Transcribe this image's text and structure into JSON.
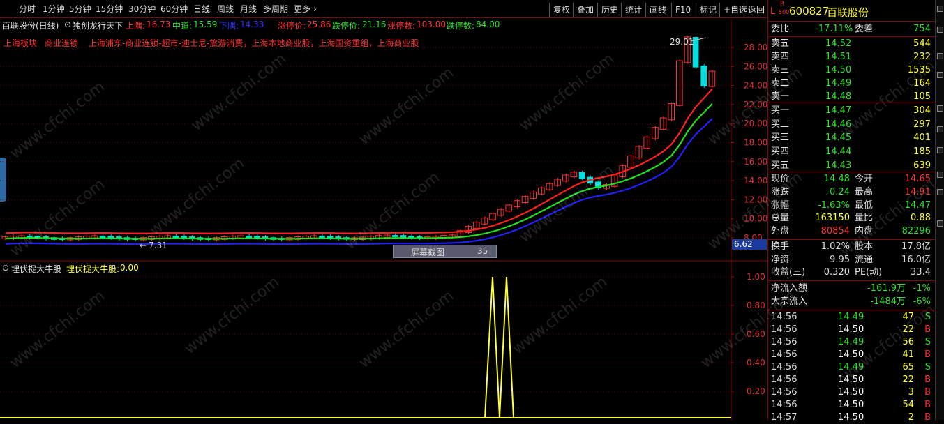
{
  "menu": {
    "period_tabs": [
      "分时",
      "1分钟",
      "5分钟",
      "15分钟",
      "30分钟",
      "60分钟",
      "日线",
      "周线",
      "月线",
      "多周期",
      "更多"
    ],
    "more_arrow": "›",
    "active_tab": "日线",
    "right_buttons": [
      "复权",
      "叠加",
      "历史",
      "统计",
      "画线",
      "F10",
      "标记",
      "+自选",
      "返回"
    ]
  },
  "chart": {
    "stock_label": "百联股份(日线)",
    "indicator_name": "独创龙行天下",
    "upper_label": "上隅:",
    "upper_value": "16.73",
    "mid_label": "中道:",
    "mid_value": "15.59",
    "lower_label": "下隅:",
    "lower_value": "14.33",
    "limit_up_price_label": "涨停价:",
    "limit_up_price": "25.86",
    "limit_down_price_label": "跌停价:",
    "limit_down_price": "21.16",
    "limit_up_count_label": "涨停数:",
    "limit_up_count": "103.00",
    "limit_down_count_label": "跌停数:",
    "limit_down_count": "84.00",
    "sector_label": "上海板块",
    "concept_1": "商业连锁",
    "concepts": "上海浦东-商业连锁-超市-迪士尼-旅游消费，上海本地商业股，上海国资重组，上海商业股",
    "y_axis_ticks": [
      "28.00",
      "26.00",
      "24.00",
      "22.00",
      "20.00",
      "18.00",
      "16.00",
      "14.00",
      "12.00",
      "10.00",
      "8.00"
    ],
    "high_mark": "29.01",
    "low_mark": "7.31",
    "current_axis_value": "6.62",
    "screenshot_tooltip": "屏幕截图",
    "screenshot_count": "35"
  },
  "sub_chart": {
    "indicator_name": "埋伏捉大牛股",
    "value_label": "埋伏捉大牛股:",
    "value": "0.00",
    "y_axis_ticks": [
      "1.00",
      "0.80",
      "0.60",
      "0.40",
      "0.20"
    ]
  },
  "quote": {
    "market_mark": "L",
    "index_mark_top": "R",
    "index_mark_bottom": "500",
    "code": "600827",
    "name": "百联股份",
    "webi_label": "委比",
    "webi_value": "-17.11%",
    "weicha_label": "委差",
    "weicha_value": "-754",
    "asks": [
      {
        "label": "卖五",
        "price": "14.52",
        "vol": "544"
      },
      {
        "label": "卖四",
        "price": "14.51",
        "vol": "232"
      },
      {
        "label": "卖三",
        "price": "14.50",
        "vol": "1535"
      },
      {
        "label": "卖二",
        "price": "14.49",
        "vol": "164"
      },
      {
        "label": "卖一",
        "price": "14.48",
        "vol": "105"
      }
    ],
    "bids": [
      {
        "label": "买一",
        "price": "14.47",
        "vol": "304"
      },
      {
        "label": "买二",
        "price": "14.46",
        "vol": "297"
      },
      {
        "label": "买三",
        "price": "14.45",
        "vol": "401"
      },
      {
        "label": "买四",
        "price": "14.44",
        "vol": "185"
      },
      {
        "label": "买五",
        "price": "14.43",
        "vol": "639"
      }
    ],
    "stats": [
      {
        "l1": "现价",
        "v1": "14.48",
        "l2": "今开",
        "v2": "14.65"
      },
      {
        "l1": "涨跌",
        "v1": "-0.24",
        "l2": "最高",
        "v2": "14.91"
      },
      {
        "l1": "涨幅",
        "v1": "-1.63%",
        "l2": "最低",
        "v2": "14.47"
      },
      {
        "l1": "总量",
        "v1": "163150",
        "l2": "量比",
        "v2": "0.88"
      },
      {
        "l1": "外盘",
        "v1": "80854",
        "l2": "内盘",
        "v2": "82296"
      }
    ],
    "stats2": [
      {
        "l1": "换手",
        "v1": "1.02%",
        "l2": "股本",
        "v2": "17.8亿"
      },
      {
        "l1": "净资",
        "v1": "9.95",
        "l2": "流通",
        "v2": "16.0亿"
      },
      {
        "l1": "收益(三)",
        "v1": "0.320",
        "l2": "PE(动)",
        "v2": "33.4"
      }
    ],
    "flows": [
      {
        "label": "净流入额",
        "value": "-161.9万",
        "pct": "-1%"
      },
      {
        "label": "大宗流入",
        "value": "-1484万",
        "pct": "-6%"
      }
    ],
    "ticks": [
      {
        "time": "14:56",
        "price": "14.49",
        "vol": "47",
        "bs": "S"
      },
      {
        "time": "14:56",
        "price": "14.50",
        "vol": "22",
        "bs": "B"
      },
      {
        "time": "14:56",
        "price": "14.49",
        "vol": "56",
        "bs": "S"
      },
      {
        "time": "14:56",
        "price": "14.50",
        "vol": "41",
        "bs": "B"
      },
      {
        "time": "14:56",
        "price": "14.49",
        "vol": "65",
        "bs": "S"
      },
      {
        "time": "14:56",
        "price": "14.50",
        "vol": "22",
        "bs": "B"
      },
      {
        "time": "14:56",
        "price": "14.50",
        "vol": "3",
        "bs": "B"
      },
      {
        "time": "14:56",
        "price": "14.50",
        "vol": "54",
        "bs": "B"
      },
      {
        "time": "14:57",
        "price": "14.50",
        "vol": "2",
        "bs": "B"
      }
    ]
  },
  "watermark": "www.cfchi.com",
  "colors": {
    "up": "#ff3232",
    "down": "#00e0e0",
    "upper": "#ff2020",
    "mid": "#20e020",
    "lower": "#2020ff",
    "signal": "#ffff40",
    "grid": "#550000"
  }
}
